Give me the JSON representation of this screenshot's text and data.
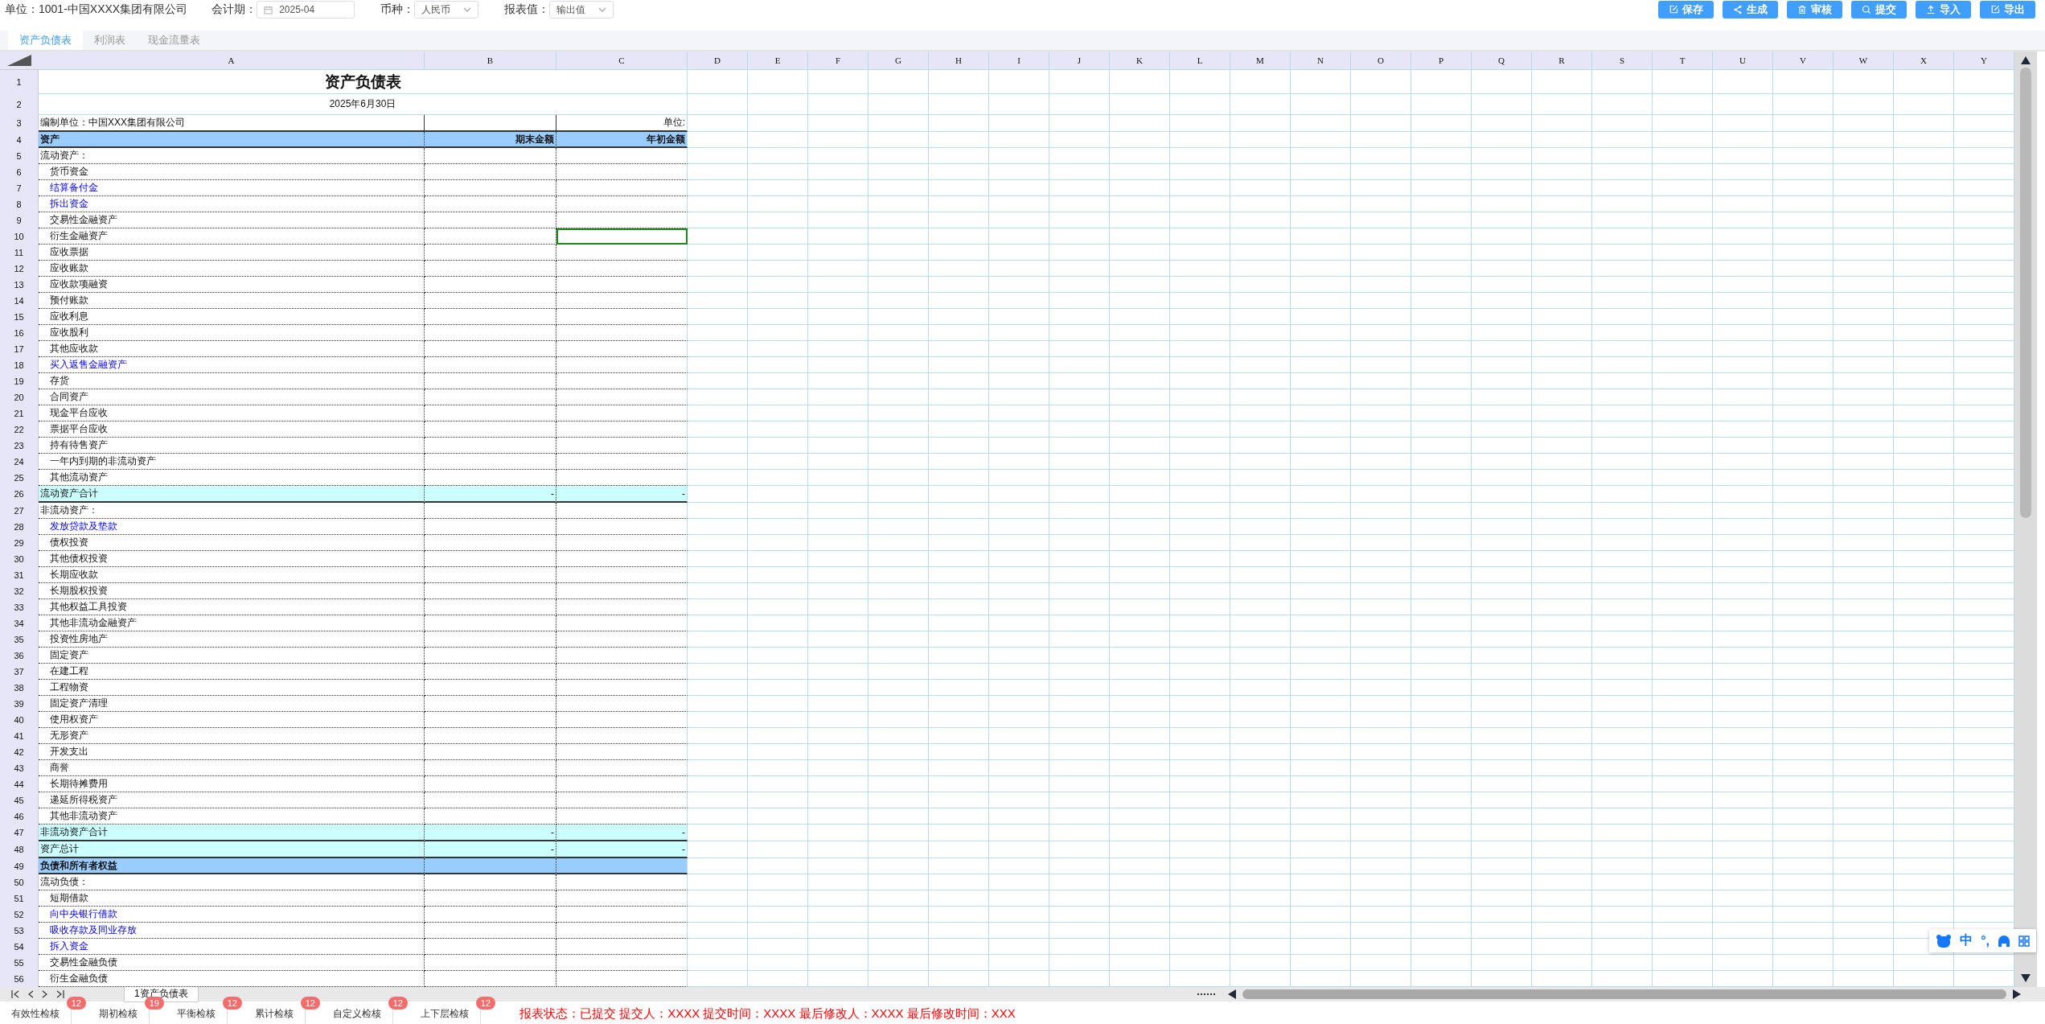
{
  "toolbar": {
    "unit_label": "单位：",
    "unit_value": "1001-中国XXXX集团有限公司",
    "fields": [
      {
        "label": "会计期：",
        "value": "2025-04",
        "kind": "date"
      },
      {
        "label": "币种：",
        "value": "人民币",
        "kind": "select"
      },
      {
        "label": "报表值：",
        "value": "输出值",
        "kind": "select"
      }
    ],
    "buttons": [
      "保存",
      "生成",
      "审核",
      "提交",
      "导入",
      "导出"
    ]
  },
  "tabs": [
    {
      "label": "资产负债表",
      "selected": true
    },
    {
      "label": "利润表",
      "selected": false
    },
    {
      "label": "现金流量表",
      "selected": false
    }
  ],
  "sheet": {
    "columns": [
      "A",
      "B",
      "C",
      "D",
      "E",
      "F",
      "G",
      "H",
      "I",
      "J",
      "K",
      "L",
      "M",
      "N",
      "O",
      "P",
      "Q",
      "R",
      "S",
      "T",
      "U",
      "V",
      "W",
      "X",
      "Y"
    ],
    "rows": [
      {
        "n": "1",
        "kind": "title",
        "a": "资产负债表",
        "selected": false
      },
      {
        "n": "2",
        "kind": "date",
        "a": "2025年6月30日",
        "selected": false
      },
      {
        "n": "3",
        "kind": "info",
        "a": "编制单位：中国XXX集团有限公司",
        "c": "单位:",
        "selected": false
      },
      {
        "n": "4",
        "kind": "header",
        "a": "资产",
        "b": "期末金额",
        "c": "年初金额",
        "selected": false
      },
      {
        "n": "5",
        "kind": "section",
        "a": "流动资产：",
        "selected": false
      },
      {
        "n": "6",
        "kind": "item",
        "a": "货币资金",
        "selected": false
      },
      {
        "n": "7",
        "kind": "link",
        "a": "结算备付金",
        "selected": false
      },
      {
        "n": "8",
        "kind": "link",
        "a": "拆出资金",
        "selected": false
      },
      {
        "n": "9",
        "kind": "item",
        "a": "交易性金融资产",
        "selected": false
      },
      {
        "n": "10",
        "kind": "item",
        "a": "衍生金融资产",
        "selected": true
      },
      {
        "n": "11",
        "kind": "item",
        "a": "应收票据",
        "selected": false
      },
      {
        "n": "12",
        "kind": "item",
        "a": "应收账款",
        "selected": false
      },
      {
        "n": "13",
        "kind": "item",
        "a": "应收款项融资",
        "selected": false
      },
      {
        "n": "14",
        "kind": "item",
        "a": "预付账款",
        "selected": false
      },
      {
        "n": "15",
        "kind": "item",
        "a": "应收利息",
        "selected": false
      },
      {
        "n": "16",
        "kind": "item",
        "a": "应收股利",
        "selected": false
      },
      {
        "n": "17",
        "kind": "item",
        "a": "其他应收款",
        "selected": false
      },
      {
        "n": "18",
        "kind": "link",
        "a": "买入返售金融资产",
        "selected": false
      },
      {
        "n": "19",
        "kind": "item",
        "a": "存货",
        "selected": false
      },
      {
        "n": "20",
        "kind": "item",
        "a": "合同资产",
        "selected": false
      },
      {
        "n": "21",
        "kind": "item",
        "a": "现金平台应收",
        "selected": false
      },
      {
        "n": "22",
        "kind": "item",
        "a": "票据平台应收",
        "selected": false
      },
      {
        "n": "23",
        "kind": "item",
        "a": "持有待售资产",
        "selected": false
      },
      {
        "n": "24",
        "kind": "item",
        "a": "一年内到期的非流动资产",
        "selected": false
      },
      {
        "n": "25",
        "kind": "item",
        "a": "其他流动资产",
        "selected": false
      },
      {
        "n": "26",
        "kind": "total",
        "a": "流动资产合计",
        "b": "-",
        "c": "-",
        "selected": false
      },
      {
        "n": "27",
        "kind": "section",
        "a": "非流动资产：",
        "selected": false
      },
      {
        "n": "28",
        "kind": "link",
        "a": "发放贷款及垫款",
        "selected": false
      },
      {
        "n": "29",
        "kind": "item",
        "a": "债权投资",
        "selected": false
      },
      {
        "n": "30",
        "kind": "item",
        "a": "其他债权投资",
        "selected": false
      },
      {
        "n": "31",
        "kind": "item",
        "a": "长期应收款",
        "selected": false
      },
      {
        "n": "32",
        "kind": "item",
        "a": "长期股权投资",
        "selected": false
      },
      {
        "n": "33",
        "kind": "item",
        "a": "其他权益工具投资",
        "selected": false
      },
      {
        "n": "34",
        "kind": "item",
        "a": "其他非流动金融资产",
        "selected": false
      },
      {
        "n": "35",
        "kind": "item",
        "a": "投资性房地产",
        "selected": false
      },
      {
        "n": "36",
        "kind": "item",
        "a": "固定资产",
        "selected": false
      },
      {
        "n": "37",
        "kind": "item",
        "a": "在建工程",
        "selected": false
      },
      {
        "n": "38",
        "kind": "item",
        "a": "工程物资",
        "selected": false
      },
      {
        "n": "39",
        "kind": "item",
        "a": "固定资产清理",
        "selected": false
      },
      {
        "n": "40",
        "kind": "item",
        "a": "使用权资产",
        "selected": false
      },
      {
        "n": "41",
        "kind": "item",
        "a": "无形资产",
        "selected": false
      },
      {
        "n": "42",
        "kind": "item",
        "a": "开发支出",
        "selected": false
      },
      {
        "n": "43",
        "kind": "item",
        "a": "商誉",
        "selected": false
      },
      {
        "n": "44",
        "kind": "item",
        "a": "长期待摊费用",
        "selected": false
      },
      {
        "n": "45",
        "kind": "item",
        "a": "递延所得税资产",
        "selected": false
      },
      {
        "n": "46",
        "kind": "item",
        "a": "其他非流动资产",
        "selected": false
      },
      {
        "n": "47",
        "kind": "total",
        "a": "非流动资产合计",
        "b": "-",
        "c": "-",
        "selected": false
      },
      {
        "n": "48",
        "kind": "total",
        "a": "资产总计",
        "b": "-",
        "c": "-",
        "selected": false
      },
      {
        "n": "49",
        "kind": "header",
        "a": "负债和所有者权益",
        "selected": false
      },
      {
        "n": "50",
        "kind": "section",
        "a": "流动负债：",
        "selected": false
      },
      {
        "n": "51",
        "kind": "item",
        "a": "短期借款",
        "selected": false
      },
      {
        "n": "52",
        "kind": "link",
        "a": "向中央银行借款",
        "selected": false
      },
      {
        "n": "53",
        "kind": "link",
        "a": "吸收存款及同业存放",
        "selected": false
      },
      {
        "n": "54",
        "kind": "link",
        "a": "拆入资金",
        "selected": false
      },
      {
        "n": "55",
        "kind": "item",
        "a": "交易性金融负债",
        "selected": false
      },
      {
        "n": "56",
        "kind": "item",
        "a": "衍生金融负债",
        "selected": false
      }
    ]
  },
  "ime_toolbar": {
    "labels": [
      "中",
      "°,"
    ]
  },
  "sheet_tabs": [
    {
      "label": "1资产负债表",
      "selected": true
    }
  ],
  "checks": [
    {
      "label": "有效性检核",
      "count": "12"
    },
    {
      "label": "期初检核",
      "count": "19"
    },
    {
      "label": "平衡检核",
      "count": "12"
    },
    {
      "label": "累计检核",
      "count": "12"
    },
    {
      "label": "自定义检核",
      "count": "12"
    },
    {
      "label": "上下层检核",
      "count": "12"
    }
  ],
  "status": "报表状态：已提交 提交人：XXXX 提交时间：XXXX 最后修改人：XXXX 最后修改时间：XXX"
}
